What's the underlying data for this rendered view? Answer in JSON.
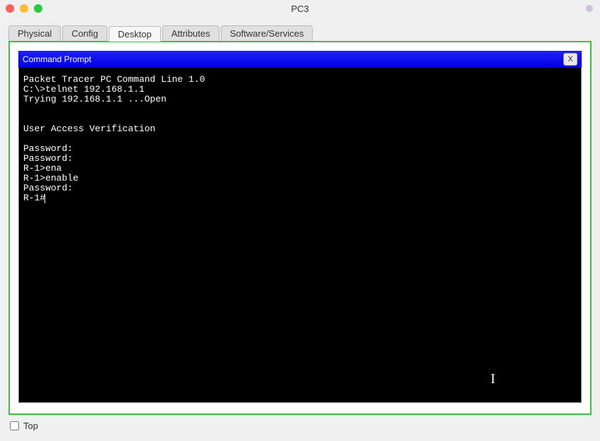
{
  "window": {
    "title": "PC3"
  },
  "tabs": [
    {
      "label": "Physical",
      "active": false
    },
    {
      "label": "Config",
      "active": false
    },
    {
      "label": "Desktop",
      "active": true
    },
    {
      "label": "Attributes",
      "active": false
    },
    {
      "label": "Software/Services",
      "active": false
    }
  ],
  "commandPrompt": {
    "title": "Command Prompt",
    "closeLabel": "X",
    "lines": [
      "Packet Tracer PC Command Line 1.0",
      "C:\\>telnet 192.168.1.1",
      "Trying 192.168.1.1 ...Open",
      "",
      "",
      "User Access Verification",
      "",
      "Password: ",
      "Password: ",
      "R-1>ena",
      "R-1>enable",
      "Password: ",
      "R-1#"
    ]
  },
  "bottom": {
    "topLabel": "Top",
    "topChecked": false
  }
}
